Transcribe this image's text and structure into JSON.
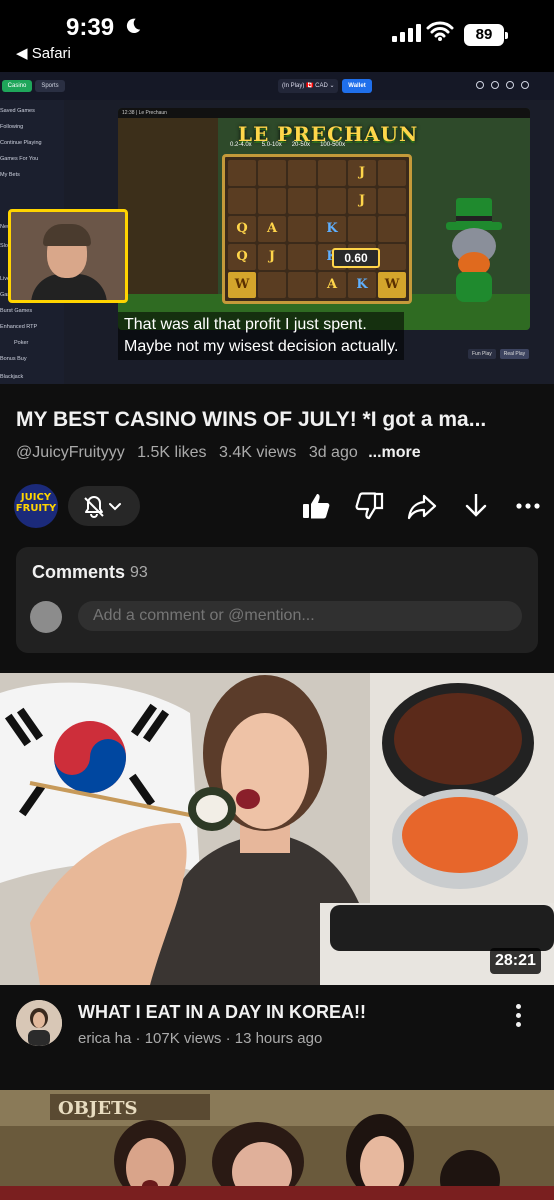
{
  "status_bar": {
    "time": "9:39",
    "back_label": "◀ Safari",
    "battery": "89"
  },
  "player": {
    "site_tabs": [
      "Casino",
      "Sports"
    ],
    "site_nav": [
      "Saved Games",
      "Following",
      "Continue Playing",
      "Games For You",
      "My Bets",
      "New R",
      "Slots",
      "Live C",
      "Game",
      "Burst Games",
      "Enhanced RTP",
      "Poker",
      "Bonus Buy",
      "Blackjack"
    ],
    "inplay_label": "(In Play) 🇨🇦 CAD ⌄",
    "wallet_label": "Wallet",
    "game_header": "12:38 | Le Prechaun",
    "game_title": "LE PRECHAUN",
    "payouts": [
      "0.2-4.0x",
      "5.0-10x",
      "20-50x",
      "100-500x"
    ],
    "multiplier": "0.60",
    "captions": [
      "That was all that profit I just spent.",
      "Maybe not my wisest decision actually."
    ],
    "play_buttons": [
      "Fun Play",
      "Real Play"
    ]
  },
  "video": {
    "title": "MY BEST CASINO WINS OF JULY! *I got a ma...",
    "channel_handle": "@JuicyFruityyy",
    "likes": "1.5K likes",
    "views": "3.4K views",
    "age": "3d ago",
    "more_label": "...more",
    "channel_logo_line1": "JUICY",
    "channel_logo_line2": "FRUITY"
  },
  "comments": {
    "label": "Comments",
    "count": "93",
    "placeholder": "Add a comment or @mention..."
  },
  "next_video": {
    "duration": "28:21",
    "title": "WHAT I EAT IN A DAY IN KOREA!!",
    "meta": "erica ha · 107K views · 13 hours ago"
  },
  "third_video": {
    "sign_text": "OBJETS"
  },
  "icons": [
    "moon-icon",
    "signal-icon",
    "wifi-icon",
    "battery-icon",
    "bell-icon",
    "like-icon",
    "dislike-icon",
    "share-icon",
    "download-icon",
    "more-icon",
    "kebab-icon"
  ],
  "colors": {
    "background": "#0f0f0f",
    "card": "#212121",
    "secondary_text": "#aaaaaa",
    "webcam_border": "#ffd400"
  }
}
